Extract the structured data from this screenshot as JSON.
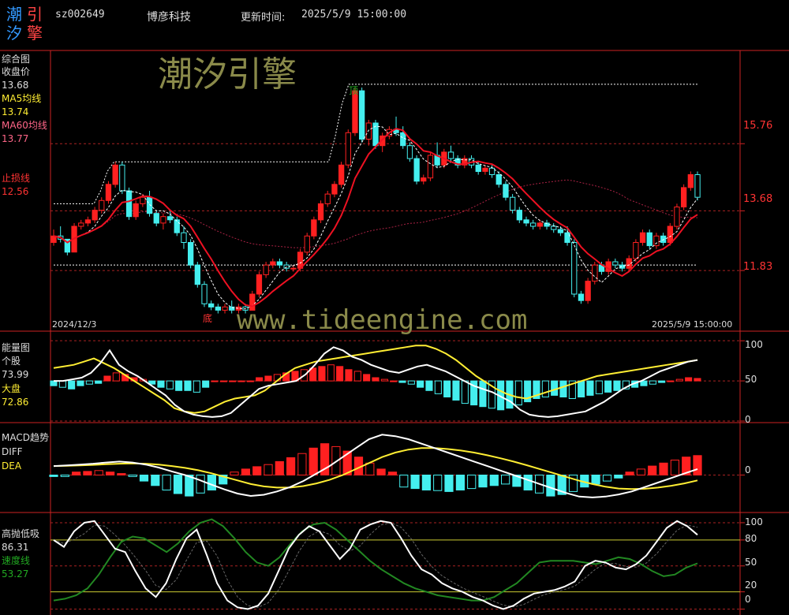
{
  "header": {
    "logo_chars": [
      "潮",
      "引",
      "汐",
      "擎"
    ],
    "code": "sz002649",
    "name": "博彦科技",
    "update_label": "更新时间:",
    "update_time": "2025/5/9 15:00:00"
  },
  "watermark": {
    "brand": "潮汐引擎",
    "url": "www.tideengine.com"
  },
  "colors": {
    "up": "#ff2020",
    "down": "#44eeee",
    "white": "#ffffff",
    "yellow": "#ffee33",
    "green": "#228822",
    "grid": "#aa2222",
    "axis": "#cc2222"
  },
  "chart_data": [
    {
      "type": "candlestick",
      "panel": "综合图",
      "legend": [
        {
          "name": "收盘价",
          "value": "13.68"
        },
        {
          "name": "MA5均线",
          "value": "13.74"
        },
        {
          "name": "MA60均线",
          "value": "13.77"
        },
        {
          "name": "止损线",
          "value": "12.56"
        }
      ],
      "ylim": [
        10.0,
        18.6
      ],
      "y_ticks": [
        "15.76",
        "13.68",
        "11.83"
      ],
      "x_start_label": "2024/12/3",
      "x_end_label": "2025/5/9 15:00:00",
      "annotations": [
        {
          "text": "顶",
          "index": 29
        },
        {
          "text": "底",
          "index": 15
        }
      ],
      "candles": [
        [
          12.7,
          13.1,
          12.6,
          12.9
        ],
        [
          12.9,
          13.2,
          12.7,
          12.8
        ],
        [
          12.8,
          12.8,
          12.3,
          12.4
        ],
        [
          12.4,
          13.3,
          12.4,
          13.2
        ],
        [
          13.2,
          13.4,
          13.1,
          13.3
        ],
        [
          13.3,
          13.5,
          13.2,
          13.4
        ],
        [
          13.4,
          13.8,
          13.3,
          13.7
        ],
        [
          13.7,
          14.1,
          13.6,
          14.0
        ],
        [
          14.0,
          14.6,
          13.9,
          14.5
        ],
        [
          14.5,
          15.2,
          14.4,
          15.1
        ],
        [
          15.1,
          15.2,
          14.2,
          14.3
        ],
        [
          14.3,
          14.4,
          13.4,
          13.5
        ],
        [
          13.5,
          14.0,
          13.4,
          13.9
        ],
        [
          13.9,
          14.2,
          13.8,
          14.1
        ],
        [
          14.1,
          14.3,
          13.5,
          13.6
        ],
        [
          13.6,
          13.7,
          13.2,
          13.3
        ],
        [
          13.3,
          13.6,
          13.1,
          13.5
        ],
        [
          13.5,
          13.7,
          13.3,
          13.4
        ],
        [
          13.4,
          13.5,
          12.9,
          13.0
        ],
        [
          13.0,
          13.2,
          12.5,
          12.7
        ],
        [
          12.7,
          12.8,
          11.9,
          12.0
        ],
        [
          12.0,
          12.1,
          11.3,
          11.4
        ],
        [
          11.4,
          11.5,
          10.7,
          10.8
        ],
        [
          10.8,
          10.9,
          10.6,
          10.7
        ],
        [
          10.7,
          10.8,
          10.5,
          10.6
        ],
        [
          10.6,
          10.8,
          10.5,
          10.7
        ],
        [
          10.7,
          10.9,
          10.5,
          10.6
        ],
        [
          10.6,
          10.8,
          10.5,
          10.7
        ],
        [
          10.7,
          10.8,
          10.5,
          10.6
        ],
        [
          10.6,
          11.2,
          10.6,
          11.1
        ],
        [
          11.1,
          11.8,
          11.0,
          11.7
        ],
        [
          11.7,
          12.1,
          11.6,
          12.0
        ],
        [
          12.0,
          12.2,
          11.9,
          12.1
        ],
        [
          12.1,
          12.2,
          11.9,
          12.0
        ],
        [
          12.0,
          12.1,
          11.8,
          11.9
        ],
        [
          11.9,
          12.0,
          11.8,
          11.9
        ],
        [
          11.9,
          12.5,
          11.8,
          12.4
        ],
        [
          12.4,
          13.0,
          12.3,
          12.9
        ],
        [
          12.9,
          13.5,
          12.8,
          13.4
        ],
        [
          13.4,
          14.0,
          13.3,
          13.9
        ],
        [
          13.9,
          14.3,
          13.8,
          14.2
        ],
        [
          14.2,
          14.6,
          14.1,
          14.5
        ],
        [
          14.5,
          15.2,
          14.4,
          15.1
        ],
        [
          15.1,
          16.2,
          15.0,
          16.1
        ],
        [
          16.1,
          17.5,
          16.0,
          17.4
        ],
        [
          17.4,
          17.5,
          15.8,
          15.9
        ],
        [
          15.9,
          16.5,
          15.7,
          16.4
        ],
        [
          16.4,
          16.5,
          15.6,
          15.7
        ],
        [
          15.7,
          16.1,
          15.5,
          16.0
        ],
        [
          16.0,
          16.3,
          15.9,
          16.2
        ],
        [
          16.2,
          16.6,
          16.0,
          16.1
        ],
        [
          16.1,
          16.3,
          15.6,
          15.7
        ],
        [
          15.7,
          15.8,
          15.2,
          15.3
        ],
        [
          15.3,
          15.4,
          14.5,
          14.6
        ],
        [
          14.6,
          14.8,
          14.5,
          14.7
        ],
        [
          14.7,
          15.5,
          14.6,
          15.4
        ],
        [
          15.4,
          15.8,
          15.0,
          15.1
        ],
        [
          15.1,
          15.6,
          15.0,
          15.5
        ],
        [
          15.5,
          15.7,
          15.2,
          15.3
        ],
        [
          15.3,
          15.4,
          15.0,
          15.1
        ],
        [
          15.1,
          15.4,
          15.0,
          15.3
        ],
        [
          15.3,
          15.4,
          15.0,
          15.1
        ],
        [
          15.1,
          15.2,
          14.8,
          14.9
        ],
        [
          14.9,
          15.1,
          14.8,
          15.0
        ],
        [
          15.0,
          15.1,
          14.7,
          14.8
        ],
        [
          14.8,
          14.9,
          14.4,
          14.5
        ],
        [
          14.5,
          14.6,
          14.0,
          14.1
        ],
        [
          14.1,
          14.2,
          13.6,
          13.7
        ],
        [
          13.7,
          13.8,
          13.3,
          13.4
        ],
        [
          13.4,
          13.5,
          13.2,
          13.3
        ],
        [
          13.3,
          13.4,
          13.1,
          13.2
        ],
        [
          13.2,
          13.4,
          13.1,
          13.3
        ],
        [
          13.3,
          13.4,
          13.1,
          13.2
        ],
        [
          13.2,
          13.3,
          13.0,
          13.1
        ],
        [
          13.1,
          13.2,
          12.9,
          13.0
        ],
        [
          13.0,
          13.2,
          12.6,
          12.7
        ],
        [
          12.7,
          12.8,
          11.0,
          11.1
        ],
        [
          11.1,
          11.2,
          10.8,
          10.9
        ],
        [
          10.9,
          11.6,
          10.8,
          11.5
        ],
        [
          11.5,
          12.1,
          11.4,
          12.0
        ],
        [
          12.0,
          12.1,
          11.7,
          11.8
        ],
        [
          11.8,
          12.2,
          11.7,
          12.1
        ],
        [
          12.1,
          12.2,
          11.9,
          12.0
        ],
        [
          12.0,
          12.1,
          11.8,
          11.9
        ],
        [
          11.9,
          12.3,
          11.8,
          12.2
        ],
        [
          12.2,
          12.8,
          12.1,
          12.7
        ],
        [
          12.7,
          13.1,
          12.6,
          13.0
        ],
        [
          13.0,
          13.1,
          12.5,
          12.6
        ],
        [
          12.6,
          13.0,
          12.5,
          12.9
        ],
        [
          12.9,
          13.0,
          12.6,
          12.7
        ],
        [
          12.7,
          13.3,
          12.6,
          13.2
        ],
        [
          13.2,
          13.9,
          13.1,
          13.8
        ],
        [
          13.8,
          14.5,
          13.7,
          14.4
        ],
        [
          14.4,
          14.9,
          14.3,
          14.8
        ],
        [
          14.8,
          14.9,
          14.0,
          14.1
        ]
      ],
      "upper_band": [
        13.9,
        13.9,
        13.9,
        13.9,
        13.9,
        13.9,
        13.9,
        14.3,
        14.9,
        15.2,
        15.2,
        15.2,
        15.2,
        15.2,
        15.2,
        15.2,
        15.2,
        15.2,
        15.2,
        15.2,
        15.2,
        15.2,
        15.2,
        15.2,
        15.2,
        15.2,
        15.2,
        15.2,
        15.2,
        15.2,
        15.2,
        15.2,
        15.2,
        15.2,
        15.2,
        15.2,
        15.2,
        15.2,
        15.2,
        15.2,
        15.2,
        15.2,
        16.0,
        17.0,
        17.6,
        17.6,
        17.6,
        17.6,
        17.6,
        17.6,
        17.6,
        17.6,
        17.6,
        17.6,
        17.6,
        17.6,
        17.6,
        17.6,
        17.6,
        17.6,
        17.6,
        17.6,
        17.6,
        17.6,
        17.6,
        17.6,
        17.6,
        17.6,
        17.6,
        17.6,
        17.6,
        17.6,
        17.6,
        17.6,
        17.6,
        17.6,
        17.6,
        17.6,
        17.6,
        17.6,
        17.6,
        17.6,
        17.6,
        17.6,
        17.6,
        17.6,
        17.6,
        17.6,
        17.6,
        17.6,
        17.6,
        17.6,
        17.6,
        17.6,
        17.6,
        17.6,
        17.6
      ],
      "lower_band": [
        12.0,
        12.0,
        12.0,
        12.0,
        12.0,
        12.0,
        12.0,
        12.0,
        12.0,
        12.0,
        12.0,
        12.0,
        12.0,
        12.0,
        12.0,
        12.0,
        12.0,
        12.0,
        12.0,
        12.0,
        12.0,
        12.0,
        12.0,
        12.0,
        12.0,
        12.0,
        12.0,
        12.0,
        12.0,
        12.0,
        12.0,
        12.0,
        12.0,
        12.0,
        12.0,
        12.0,
        12.0,
        12.0,
        12.0,
        12.0,
        12.0,
        12.0,
        12.0,
        12.0,
        12.0,
        12.0,
        12.0,
        12.0,
        12.0,
        12.0,
        12.0,
        12.0,
        12.0,
        12.0,
        12.0,
        12.0,
        12.0,
        12.0,
        12.0,
        12.0,
        12.0,
        12.0,
        12.0,
        12.0,
        12.0,
        12.0,
        12.0,
        12.0,
        12.0,
        12.0,
        12.0,
        12.0,
        12.0,
        12.0,
        12.0,
        12.0,
        12.0,
        12.0,
        12.0,
        12.0,
        12.0,
        12.0,
        12.0,
        12.0,
        12.0,
        12.0,
        12.0,
        12.0,
        12.0,
        12.0,
        12.0,
        12.0,
        12.0,
        12.0,
        12.0,
        12.0,
        12.0
      ]
    },
    {
      "type": "bar_line",
      "panel": "能量图",
      "legend": [
        {
          "name": "个股",
          "value": "73.99"
        },
        {
          "name": "大盘",
          "value": "72.86"
        }
      ],
      "ylim": [
        0,
        110
      ],
      "y_ticks": [
        100,
        50,
        0
      ],
      "white": [
        50,
        50,
        52,
        54,
        60,
        72,
        88,
        70,
        62,
        56,
        48,
        40,
        32,
        20,
        12,
        8,
        6,
        5,
        6,
        10,
        20,
        30,
        40,
        44,
        46,
        48,
        50,
        58,
        70,
        84,
        92,
        88,
        80,
        76,
        70,
        66,
        62,
        60,
        64,
        68,
        70,
        66,
        62,
        56,
        50,
        44,
        40,
        36,
        30,
        24,
        14,
        8,
        6,
        5,
        6,
        8,
        10,
        12,
        18,
        24,
        32,
        40,
        46,
        50,
        56,
        62,
        66,
        70,
        74,
        76
      ],
      "yellow": [
        66,
        68,
        70,
        74,
        78,
        72,
        66,
        58,
        50,
        42,
        34,
        26,
        16,
        12,
        10,
        12,
        18,
        24,
        28,
        30,
        32,
        38,
        48,
        58,
        66,
        70,
        74,
        76,
        78,
        80,
        82,
        84,
        86,
        88,
        90,
        92,
        94,
        94,
        90,
        84,
        76,
        66,
        56,
        48,
        40,
        34,
        30,
        28,
        32,
        36,
        40,
        44,
        48,
        52,
        56,
        58,
        60,
        62,
        64,
        66,
        68,
        70,
        72,
        74,
        76
      ],
      "bars": [
        -6,
        -8,
        -10,
        -6,
        -4,
        -3,
        6,
        10,
        8,
        4,
        2,
        -4,
        -8,
        -10,
        -12,
        -12,
        -14,
        -8,
        0,
        0,
        0,
        0,
        0,
        4,
        6,
        8,
        10,
        12,
        14,
        16,
        18,
        20,
        18,
        14,
        12,
        8,
        4,
        2,
        0,
        -2,
        -4,
        -8,
        -12,
        -16,
        -20,
        -24,
        -28,
        -30,
        -32,
        -34,
        -36,
        -34,
        -30,
        -26,
        -22,
        -20,
        -18,
        -20,
        -22,
        -20,
        -18,
        -16,
        -14,
        -12,
        -10,
        -8,
        -6,
        -4,
        -2,
        0,
        2,
        4,
        3
      ]
    },
    {
      "type": "macd",
      "panel": "MACD趋势",
      "legend": [
        {
          "name": "DIFF",
          "value": ""
        },
        {
          "name": "DEA",
          "value": ""
        }
      ],
      "ylim": [
        -1.2,
        1.7
      ],
      "y_ticks": [
        0
      ],
      "diff": [
        0.3,
        0.32,
        0.35,
        0.38,
        0.42,
        0.45,
        0.42,
        0.35,
        0.25,
        0.12,
        0.0,
        -0.15,
        -0.32,
        -0.48,
        -0.62,
        -0.7,
        -0.66,
        -0.55,
        -0.4,
        -0.2,
        0.05,
        0.3,
        0.6,
        0.9,
        1.2,
        1.35,
        1.3,
        1.2,
        1.05,
        0.9,
        0.75,
        0.6,
        0.45,
        0.3,
        0.15,
        0.0,
        -0.15,
        -0.3,
        -0.45,
        -0.6,
        -0.72,
        -0.75,
        -0.72,
        -0.65,
        -0.55,
        -0.4,
        -0.25,
        -0.1,
        0.05,
        0.2
      ],
      "dea": [
        0.3,
        0.31,
        0.32,
        0.34,
        0.36,
        0.38,
        0.39,
        0.38,
        0.35,
        0.3,
        0.24,
        0.16,
        0.06,
        -0.06,
        -0.18,
        -0.3,
        -0.38,
        -0.42,
        -0.42,
        -0.37,
        -0.28,
        -0.16,
        0.0,
        0.2,
        0.4,
        0.6,
        0.75,
        0.85,
        0.9,
        0.9,
        0.87,
        0.82,
        0.75,
        0.66,
        0.56,
        0.45,
        0.33,
        0.2,
        0.07,
        -0.06,
        -0.19,
        -0.3,
        -0.39,
        -0.45,
        -0.47,
        -0.46,
        -0.42,
        -0.36,
        -0.28,
        -0.18
      ],
      "bars": [
        -0.05,
        -0.05,
        0.1,
        0.12,
        0.15,
        0.1,
        0.05,
        -0.05,
        -0.2,
        -0.35,
        -0.5,
        -0.62,
        -0.7,
        -0.6,
        -0.5,
        -0.3,
        0.1,
        0.2,
        0.28,
        0.35,
        0.45,
        0.58,
        0.72,
        0.9,
        1.05,
        0.95,
        0.8,
        0.6,
        0.4,
        0.2,
        0.1,
        -0.4,
        -0.45,
        -0.5,
        -0.52,
        -0.55,
        -0.5,
        -0.45,
        -0.4,
        -0.35,
        -0.3,
        -0.38,
        -0.5,
        -0.6,
        -0.7,
        -0.65,
        -0.55,
        -0.4,
        -0.3,
        -0.2,
        -0.1,
        0.1,
        0.2,
        0.3,
        0.4,
        0.5,
        0.6,
        0.65
      ]
    },
    {
      "type": "line",
      "panel": "高抛低吸",
      "legend": [
        {
          "name": "高抛低吸",
          "value": "86.31"
        },
        {
          "name": "速度线",
          "value": "53.27"
        }
      ],
      "ylim": [
        -5,
        110
      ],
      "y_ticks": [
        100,
        80,
        50,
        20,
        0
      ],
      "white": [
        80,
        72,
        90,
        100,
        102,
        86,
        70,
        66,
        44,
        24,
        14,
        30,
        58,
        82,
        92,
        62,
        30,
        10,
        2,
        0,
        4,
        18,
        44,
        70,
        86,
        96,
        90,
        74,
        58,
        70,
        92,
        98,
        102,
        100,
        82,
        62,
        46,
        40,
        30,
        24,
        20,
        14,
        10,
        4,
        0,
        4,
        12,
        18,
        20,
        22,
        26,
        32,
        50,
        56,
        54,
        48,
        46,
        52,
        62,
        78,
        94,
        102,
        96,
        86
      ],
      "green": [
        10,
        12,
        16,
        24,
        40,
        60,
        78,
        84,
        82,
        74,
        66,
        76,
        90,
        100,
        104,
        96,
        82,
        66,
        54,
        50,
        60,
        76,
        90,
        98,
        100,
        92,
        80,
        68,
        56,
        46,
        38,
        30,
        24,
        20,
        16,
        14,
        12,
        10,
        10,
        14,
        22,
        30,
        42,
        54,
        56,
        56,
        56,
        54,
        52,
        56,
        60,
        58,
        52,
        44,
        38,
        40,
        48,
        53
      ]
    }
  ]
}
